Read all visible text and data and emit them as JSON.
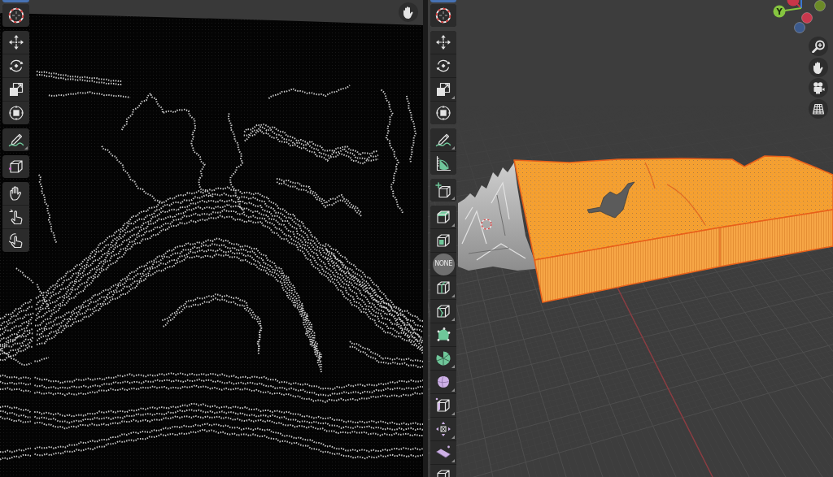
{
  "left_viewport": {
    "navigation": [
      {
        "kind": "pan"
      }
    ],
    "toolbar": [
      {
        "tools": [
          {
            "kind": "select",
            "selected": true,
            "more": false
          }
        ]
      },
      {
        "tools": [
          {
            "kind": "cursor",
            "selected": false,
            "more": false
          }
        ]
      },
      {
        "tools": [
          {
            "kind": "move",
            "selected": false,
            "more": false
          },
          {
            "kind": "rotate",
            "selected": false,
            "more": false
          },
          {
            "kind": "scale",
            "selected": false,
            "more": false
          },
          {
            "kind": "transform",
            "selected": false,
            "more": false
          }
        ]
      },
      {
        "tools": [
          {
            "kind": "annotate",
            "selected": false,
            "more": true
          }
        ]
      },
      {
        "tools": [
          {
            "kind": "cube",
            "selected": false,
            "more": false
          }
        ]
      },
      {
        "tools": [
          {
            "kind": "grab",
            "selected": false,
            "more": false
          },
          {
            "kind": "tweak",
            "selected": false,
            "more": false
          },
          {
            "kind": "tweak_alt",
            "selected": false,
            "more": false
          }
        ]
      }
    ]
  },
  "right_viewport": {
    "gizmo": {
      "axes": [
        {
          "kind": "clipped",
          "color": "#c93548"
        },
        {
          "kind": "line",
          "color": "#3b78d0"
        },
        {
          "kind": "labeled",
          "label": "Y",
          "color": "#86c540"
        },
        {
          "kind": "negative",
          "color": "#c8384d"
        },
        {
          "kind": "negative",
          "color": "#3c5a8c"
        },
        {
          "kind": "negative",
          "color": "#6b8a28"
        }
      ]
    },
    "navigation": [
      {
        "kind": "zoom"
      },
      {
        "kind": "pan"
      },
      {
        "kind": "camera"
      },
      {
        "kind": "grid"
      }
    ],
    "toolbar": [
      {
        "tools": [
          {
            "kind": "select",
            "selected": true,
            "more": false
          }
        ]
      },
      {
        "tools": [
          {
            "kind": "cursor",
            "selected": false,
            "more": false
          }
        ]
      },
      {
        "tools": [
          {
            "kind": "move",
            "selected": false,
            "more": false
          },
          {
            "kind": "rotate",
            "selected": false,
            "more": false
          },
          {
            "kind": "scale",
            "selected": false,
            "more": true
          },
          {
            "kind": "transform",
            "selected": false,
            "more": false
          }
        ]
      },
      {
        "tools": [
          {
            "kind": "annotate",
            "selected": false,
            "more": true
          },
          {
            "kind": "measure",
            "selected": false,
            "more": false
          }
        ]
      },
      {
        "tools": [
          {
            "kind": "add_cube",
            "selected": false,
            "more": true
          }
        ]
      },
      {
        "tools": [
          {
            "kind": "extrude",
            "selected": false,
            "more": true
          },
          {
            "kind": "inset",
            "selected": false,
            "more": false
          },
          {
            "kind": "none",
            "label": "NONE",
            "selected": false,
            "more": false
          },
          {
            "kind": "loop_cut",
            "selected": false,
            "more": true
          },
          {
            "kind": "knife",
            "selected": false,
            "more": true
          },
          {
            "kind": "poly_build",
            "selected": false,
            "more": false
          },
          {
            "kind": "spin",
            "selected": false,
            "more": true
          },
          {
            "kind": "smooth",
            "selected": false,
            "more": true
          },
          {
            "kind": "shrink",
            "selected": false,
            "more": true
          },
          {
            "kind": "push",
            "selected": false,
            "more": true
          },
          {
            "kind": "shear",
            "selected": false,
            "more": true
          },
          {
            "kind": "box",
            "selected": false,
            "more": false
          }
        ]
      }
    ]
  }
}
